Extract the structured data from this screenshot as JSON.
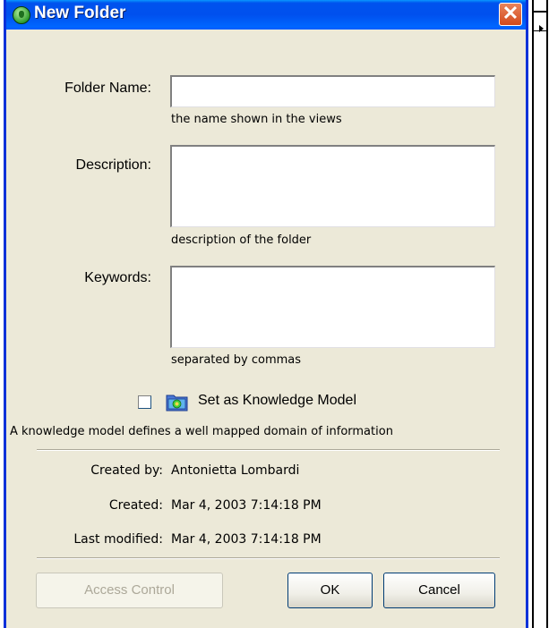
{
  "window": {
    "title": "New Folder",
    "close_icon": "close-icon"
  },
  "form": {
    "folder_name": {
      "label": "Folder Name:",
      "value": "",
      "hint": "the name shown in the views"
    },
    "description": {
      "label": "Description:",
      "value": "",
      "hint": "description of the folder"
    },
    "keywords": {
      "label": "Keywords:",
      "value": "",
      "hint": "separated by commas"
    }
  },
  "knowledge_model": {
    "checked": false,
    "label": "Set as Knowledge Model",
    "description": "A knowledge model defines a well mapped domain of information"
  },
  "meta": {
    "created_by_label": "Created by:",
    "created_by_value": "Antonietta Lombardi",
    "created_label": "Created:",
    "created_value": "Mar 4, 2003 7:14:18 PM",
    "modified_label": "Last modified:",
    "modified_value": "Mar 4, 2003 7:14:18 PM"
  },
  "buttons": {
    "access_control": "Access Control",
    "ok": "OK",
    "cancel": "Cancel"
  },
  "colors": {
    "title_bar": "#0054e3",
    "dialog_bg": "#ece9d8",
    "close_button": "#d44a1c"
  }
}
